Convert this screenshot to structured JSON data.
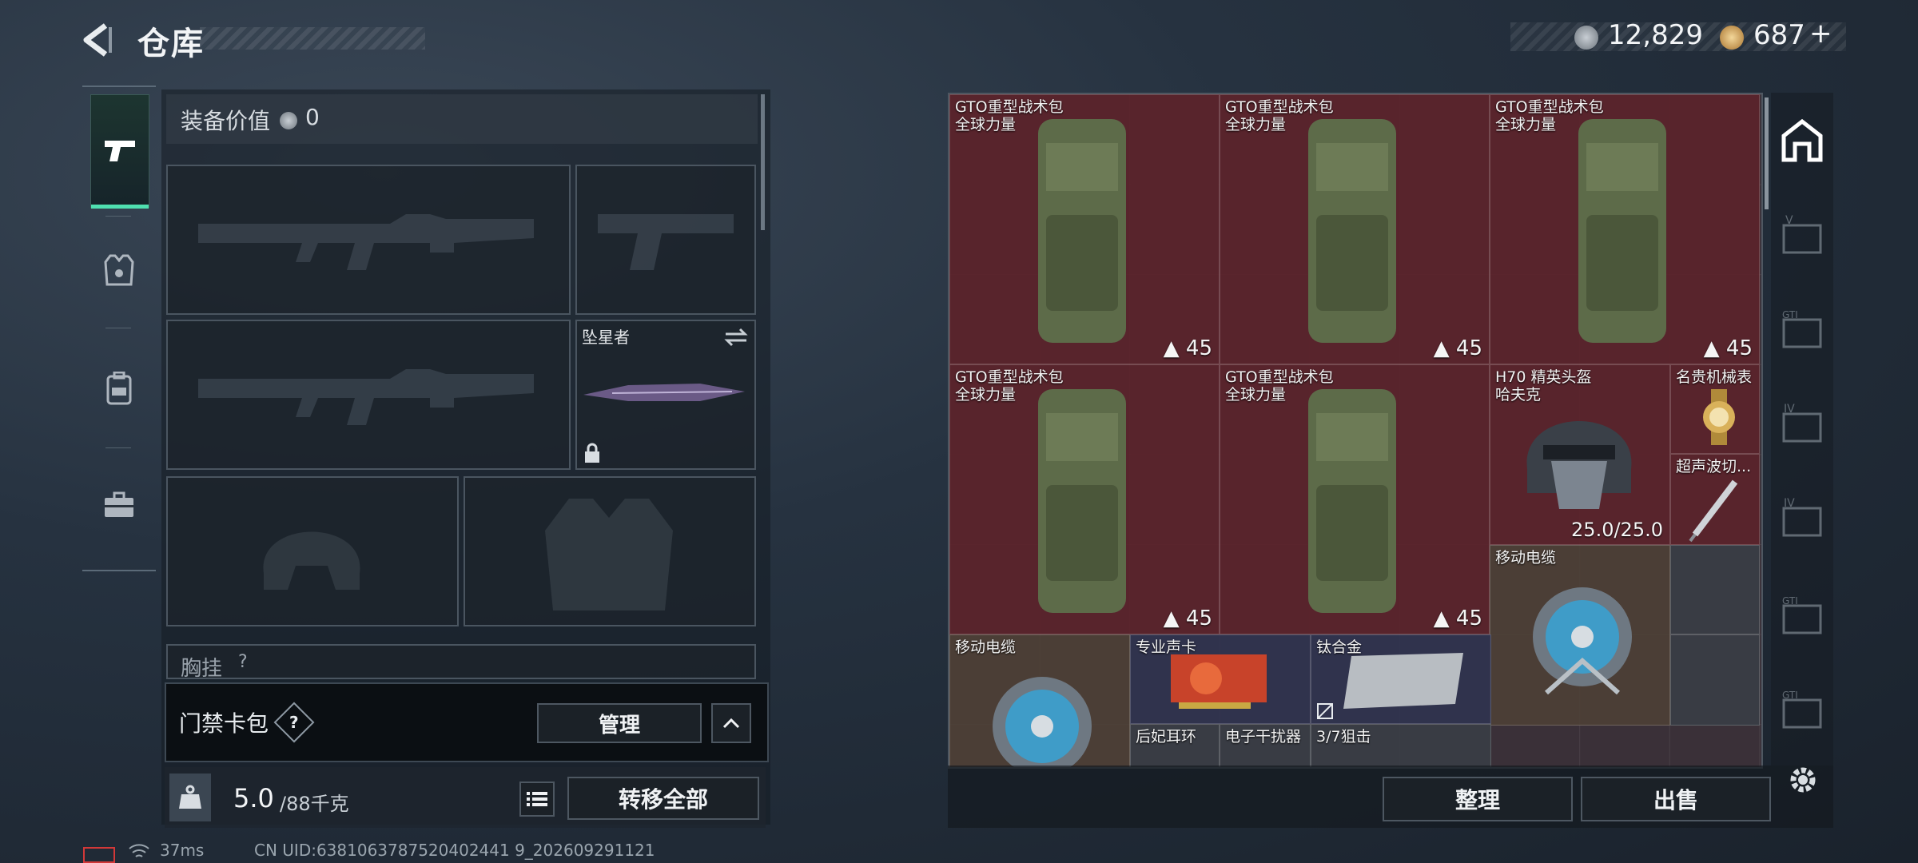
{
  "header": {
    "title": "仓库"
  },
  "currency": {
    "coins": "12,829",
    "tokens": "687",
    "add_symbol": "+"
  },
  "left_nav": [
    {
      "icon": "gun-icon",
      "active": true
    },
    {
      "icon": "armor-vest-icon",
      "active": false
    },
    {
      "icon": "backpack-icon",
      "active": false
    },
    {
      "icon": "toolbox-icon",
      "active": false
    }
  ],
  "equipment": {
    "value_label": "装备价值",
    "value": "0",
    "melee_name": "坠星者",
    "chest_label": "胸挂",
    "chest_help": "?"
  },
  "keycard": {
    "label": "门禁卡包",
    "help": "?",
    "manage": "管理"
  },
  "capacity": {
    "current": "5.0",
    "max": "/88千克",
    "transfer_all": "转移全部"
  },
  "grid_items": [
    {
      "name1": "GTO重型战术包",
      "name2": "全球力量",
      "count": "45"
    },
    {
      "name1": "GTO重型战术包",
      "name2": "全球力量",
      "count": "45"
    },
    {
      "name1": "GTO重型战术包",
      "name2": "全球力量",
      "count": "45"
    },
    {
      "name1": "GTO重型战术包",
      "name2": "全球力量",
      "count": "45"
    },
    {
      "name1": "GTO重型战术包",
      "name2": "全球力量",
      "count": "45"
    },
    {
      "name1": "H70 精英头盔",
      "name2": "哈夫克",
      "durability": "25.0/25.0"
    },
    {
      "name1": "名贵机械表"
    },
    {
      "name1": "超声波切..."
    },
    {
      "name1": "移动电缆"
    },
    {
      "name1": "移动电缆"
    },
    {
      "name1": "专业声卡"
    },
    {
      "name1": "钛合金"
    },
    {
      "name1": "后妃耳环"
    },
    {
      "name1": "电子干扰器"
    },
    {
      "name1": "3/7狙击"
    }
  ],
  "footer": {
    "sort": "整理",
    "sell": "出售"
  },
  "status": {
    "latency": "37ms",
    "uid": "CN UID:6381063787520402441 9_202609291121"
  },
  "colors": {
    "accent": "#4fe0b0",
    "item_red": "#5c222a"
  }
}
